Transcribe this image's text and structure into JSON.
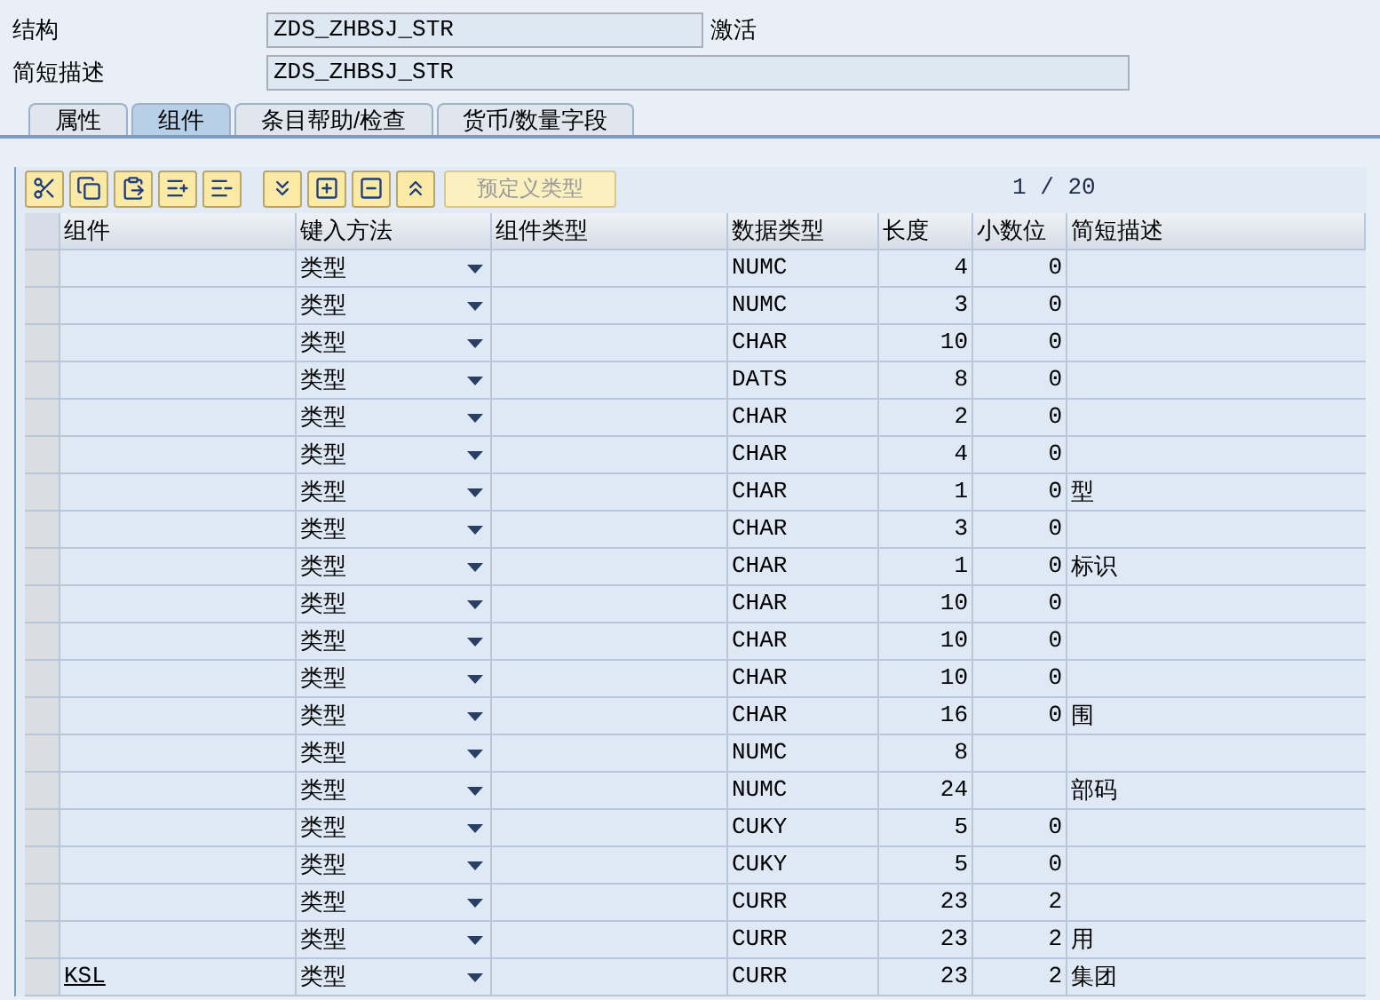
{
  "fields": [
    {
      "label": "结构",
      "value": "ZDS_ZHBSJ_STR",
      "status": "激活"
    },
    {
      "label": "简短描述",
      "value": "ZDS_ZHBSJ_STR"
    }
  ],
  "tabs": [
    {
      "label": "属性",
      "selected": false
    },
    {
      "label": "组件",
      "selected": true
    },
    {
      "label": "条目帮助/检查",
      "selected": false
    },
    {
      "label": "货币/数量字段",
      "selected": false
    }
  ],
  "toolbar": {
    "tools": [
      {
        "kind": "cut"
      },
      {
        "kind": "copy"
      },
      {
        "kind": "paste"
      },
      {
        "kind": "insert-row"
      },
      {
        "kind": "delete-row"
      },
      {
        "kind": "separator"
      },
      {
        "kind": "filter"
      },
      {
        "kind": "insert"
      },
      {
        "kind": "remove"
      },
      {
        "kind": "collapse"
      }
    ],
    "predefined_button": {
      "label": "预定义类型",
      "disabled": true
    }
  },
  "page_indicator": "1 / 20",
  "table": {
    "columns": [
      "组件",
      "键入方法",
      "组件类型",
      "数据类型",
      "长度",
      "小数位",
      "简短描述"
    ],
    "rows": [
      {
        "entry_method": "类型",
        "data_type": "NUMC",
        "length": "4",
        "decimals": "0"
      },
      {
        "entry_method": "类型",
        "data_type": "NUMC",
        "length": "3",
        "decimals": "0"
      },
      {
        "entry_method": "类型",
        "data_type": "CHAR",
        "length": "10",
        "decimals": "0"
      },
      {
        "entry_method": "类型",
        "data_type": "DATS",
        "length": "8",
        "decimals": "0"
      },
      {
        "entry_method": "类型",
        "data_type": "CHAR",
        "length": "2",
        "decimals": "0"
      },
      {
        "entry_method": "类型",
        "data_type": "CHAR",
        "length": "4",
        "decimals": "0"
      },
      {
        "entry_method": "类型",
        "data_type": "CHAR",
        "length": "1",
        "decimals": "0",
        "description": "型"
      },
      {
        "entry_method": "类型",
        "data_type": "CHAR",
        "length": "3",
        "decimals": "0"
      },
      {
        "entry_method": "类型",
        "data_type": "CHAR",
        "length": "1",
        "decimals": "0",
        "description": "标识"
      },
      {
        "entry_method": "类型",
        "data_type": "CHAR",
        "length": "10",
        "decimals": "0"
      },
      {
        "entry_method": "类型",
        "data_type": "CHAR",
        "length": "10",
        "decimals": "0"
      },
      {
        "entry_method": "类型",
        "data_type": "CHAR",
        "length": "10",
        "decimals": "0"
      },
      {
        "entry_method": "类型",
        "data_type": "CHAR",
        "length": "16",
        "decimals": "0",
        "description": "围"
      },
      {
        "entry_method": "类型",
        "data_type": "NUMC",
        "length": "8"
      },
      {
        "entry_method": "类型",
        "data_type": "NUMC",
        "length": "24",
        "description": "部码"
      },
      {
        "entry_method": "类型",
        "data_type": "CUKY",
        "length": "5",
        "decimals": "0"
      },
      {
        "entry_method": "类型",
        "data_type": "CUKY",
        "length": "5",
        "decimals": "0"
      },
      {
        "entry_method": "类型",
        "data_type": "CURR",
        "length": "23",
        "decimals": "2"
      },
      {
        "entry_method": "类型",
        "data_type": "CURR",
        "length": "23",
        "decimals": "2",
        "description": "用"
      },
      {
        "component": "KSL",
        "entry_method": "类型",
        "data_type": "CURR",
        "length": "23",
        "decimals": "2",
        "description": "集团"
      }
    ]
  }
}
